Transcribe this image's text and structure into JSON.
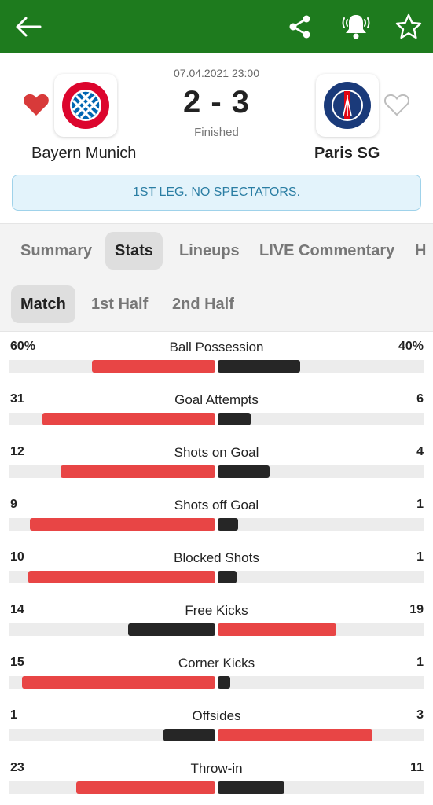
{
  "colors": {
    "header_green": "#1e7b1e",
    "leading_bar": "#e84545",
    "trailing_bar": "#262626",
    "favorite_red": "#d83a3a"
  },
  "topbar": {
    "icons": [
      "back-arrow-icon",
      "share-icon",
      "bell-icon",
      "star-icon"
    ]
  },
  "match": {
    "datetime": "07.04.2021 23:00",
    "score": "2 - 3",
    "status": "Finished",
    "home": {
      "name": "Bayern Munich",
      "logo_text": "FC BAYERN MÜNCHEN",
      "favorited": true
    },
    "away": {
      "name": "Paris SG",
      "logo_text": "PARIS SAINT-GERMAIN",
      "favorited": false
    },
    "note": "1ST LEG. NO SPECTATORS."
  },
  "tabs": [
    {
      "label": "Summary",
      "active": false
    },
    {
      "label": "Stats",
      "active": true
    },
    {
      "label": "Lineups",
      "active": false
    },
    {
      "label": "LIVE Commentary",
      "active": false
    },
    {
      "label": "H",
      "active": false
    }
  ],
  "subtabs": [
    {
      "label": "Match",
      "active": true
    },
    {
      "label": "1st Half",
      "active": false
    },
    {
      "label": "2nd Half",
      "active": false
    }
  ],
  "stats": [
    {
      "label": "Ball Possession",
      "home": "60%",
      "away": "40%",
      "home_val": 60,
      "away_val": 40,
      "max": 100
    },
    {
      "label": "Goal Attempts",
      "home": "31",
      "away": "6",
      "home_val": 31,
      "away_val": 6,
      "max": 37
    },
    {
      "label": "Shots on Goal",
      "home": "12",
      "away": "4",
      "home_val": 12,
      "away_val": 4,
      "max": 16
    },
    {
      "label": "Shots off Goal",
      "home": "9",
      "away": "1",
      "home_val": 9,
      "away_val": 1,
      "max": 10
    },
    {
      "label": "Blocked Shots",
      "home": "10",
      "away": "1",
      "home_val": 10,
      "away_val": 1,
      "max": 11
    },
    {
      "label": "Free Kicks",
      "home": "14",
      "away": "19",
      "home_val": 14,
      "away_val": 19,
      "max": 33
    },
    {
      "label": "Corner Kicks",
      "home": "15",
      "away": "1",
      "home_val": 15,
      "away_val": 1,
      "max": 16
    },
    {
      "label": "Offsides",
      "home": "1",
      "away": "3",
      "home_val": 1,
      "away_val": 3,
      "max": 4
    },
    {
      "label": "Throw-in",
      "home": "23",
      "away": "11",
      "home_val": 23,
      "away_val": 11,
      "max": 34
    }
  ]
}
